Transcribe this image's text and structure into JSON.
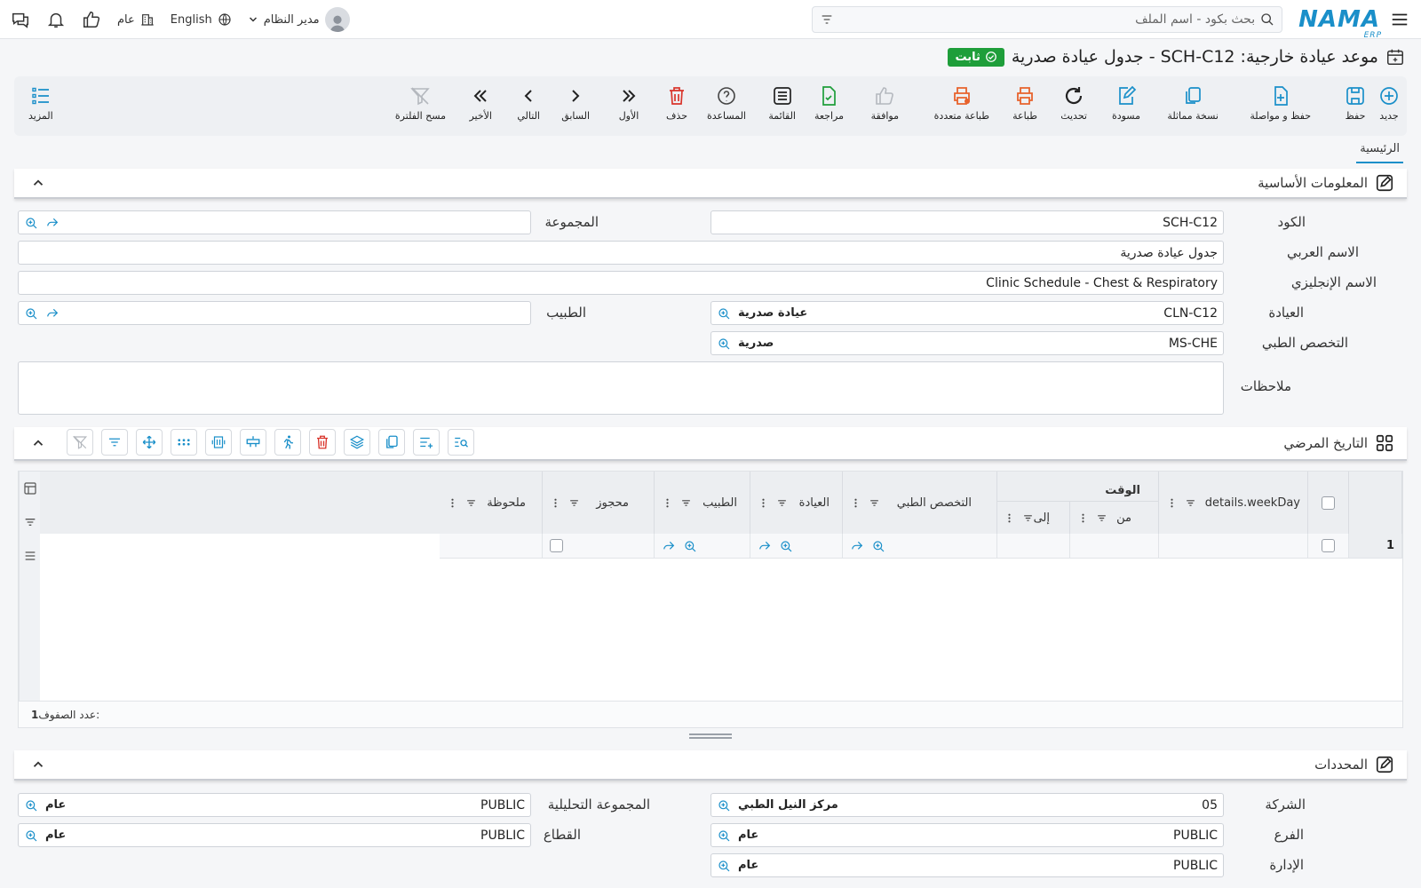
{
  "topbar": {
    "logo": "NAMA",
    "logo_sub": "ERP",
    "search_placeholder": "بحث بكود - اسم الملف",
    "user": "مدير النظام",
    "language": "English",
    "company": "عام"
  },
  "title": {
    "text": "موعد عيادة خارجية: SCH-C12 - جدول عيادة صدرية",
    "status": "ثابت"
  },
  "toolbar": {
    "new": "جديد",
    "save": "حفظ",
    "save_continue": "حفظ و مواصلة",
    "duplicate": "نسخة مماثلة",
    "draft": "مسودة",
    "refresh": "تحديث",
    "print": "طباعة",
    "multi_print": "طباعة متعددة",
    "approve": "موافقة",
    "review": "مراجعة",
    "list": "القائمة",
    "help": "المساعدة",
    "delete": "حذف",
    "first": "الأول",
    "previous": "السابق",
    "next": "التالي",
    "last": "الأخير",
    "clear_filter": "مسح الفلترة",
    "more": "المزيد"
  },
  "tabs": [
    "الرئيسية"
  ],
  "basic": {
    "title": "المعلومات الأساسية",
    "code_label": "الكود",
    "code": "SCH-C12",
    "group_label": "المجموعة",
    "group": "",
    "arabic_name_label": "الاسم العربي",
    "arabic_name": "جدول عيادة صدرية",
    "english_name_label": "الاسم الإنجليزي",
    "english_name": "Clinic Schedule - Chest & Respiratory",
    "clinic_label": "العيادة",
    "clinic_code": "CLN-C12",
    "clinic_name": "عيادة صدرية",
    "doctor_label": "الطبيب",
    "doctor": "",
    "specialty_label": "التخصص الطبي",
    "specialty_code": "MS-CHE",
    "specialty_name": "صدرية",
    "notes_label": "ملاحظات"
  },
  "history": {
    "title": "التاريخ المرضي",
    "columns": {
      "weekday": "details.weekDay",
      "time": "الوقت",
      "from": "من",
      "to": "إلى",
      "specialty": "التخصص الطبي",
      "clinic": "العيادة",
      "doctor": "الطبيب",
      "reserved": "محجوز",
      "note": "ملحوظة"
    },
    "rows": [
      {
        "num": "1"
      }
    ],
    "row_count_label": "عدد الصفوف:",
    "row_count": "1"
  },
  "determinants": {
    "title": "المحددات",
    "company_label": "الشركة",
    "company_code": "05",
    "company_name": "مركز النيل الطبي",
    "analytic_label": "المجموعة التحليلية",
    "analytic_code": "PUBLIC",
    "analytic_name": "عام",
    "branch_label": "الفرع",
    "branch_code": "PUBLIC",
    "branch_name": "عام",
    "sector_label": "القطاع",
    "sector_code": "PUBLIC",
    "sector_name": "عام",
    "department_label": "الإدارة",
    "department_code": "PUBLIC",
    "department_name": "عام"
  },
  "colors": {
    "accent": "#1a8fc9",
    "status_green": "#1e9e3a",
    "orange": "#e8622c",
    "delete_red": "#d9342b"
  }
}
